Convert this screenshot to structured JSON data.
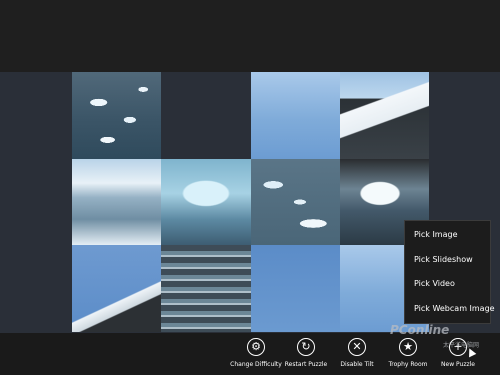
{
  "menu": {
    "items": [
      "Pick Image",
      "Pick Slideshow",
      "Pick Video",
      "Pick Webcam Image"
    ]
  },
  "appbar": {
    "buttons": [
      {
        "label": "Change Difficulty",
        "icon": "gear-icon",
        "glyph": "⚙"
      },
      {
        "label": "Restart Puzzle",
        "icon": "refresh-icon",
        "glyph": "↻"
      },
      {
        "label": "Disable Tilt",
        "icon": "close-icon",
        "glyph": "✕"
      },
      {
        "label": "Trophy Room",
        "icon": "star-icon",
        "glyph": "★"
      },
      {
        "label": "New Puzzle",
        "icon": "plus-icon",
        "glyph": "+"
      }
    ]
  },
  "watermark": {
    "logo": "PConline",
    "subtitle": "太平洋电脑网"
  },
  "colors": {
    "background": "#1f1f1f",
    "stage": "#2a2f38",
    "menu_bg": "#1c1c1c",
    "text": "#ffffff"
  }
}
